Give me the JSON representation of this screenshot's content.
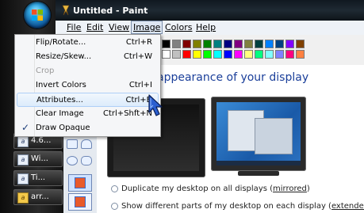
{
  "window": {
    "title": "Untitled - Paint"
  },
  "menubar": {
    "items": [
      {
        "label": "File"
      },
      {
        "label": "Edit"
      },
      {
        "label": "View"
      },
      {
        "label": "Image"
      },
      {
        "label": "Colors"
      },
      {
        "label": "Help"
      }
    ]
  },
  "image_menu": {
    "items": [
      {
        "label": "Flip/Rotate...",
        "shortcut": "Ctrl+R"
      },
      {
        "label": "Resize/Skew...",
        "shortcut": "Ctrl+W"
      },
      {
        "label": "Crop",
        "shortcut": ""
      },
      {
        "label": "Invert Colors",
        "shortcut": "Ctrl+I"
      },
      {
        "label": "Attributes...",
        "shortcut": "Ctrl+E"
      },
      {
        "label": "Clear Image",
        "shortcut": "Ctrl+Shft+N"
      },
      {
        "label": "Draw Opaque",
        "shortcut": "",
        "check": "✓"
      }
    ]
  },
  "taskbar": {
    "items": [
      {
        "label": "4.6...",
        "icon": "document-icon"
      },
      {
        "label": "Wi...",
        "icon": "document-icon"
      },
      {
        "label": "Ti...",
        "icon": "document-icon"
      },
      {
        "label": "arr...",
        "icon": "document-icon"
      }
    ]
  },
  "content": {
    "heading": "appearance of your display",
    "options": [
      {
        "pre": "Duplicate my desktop on all displays (",
        "u": "mirrored",
        "post": ")"
      },
      {
        "pre": "Show different parts of my desktop on each display (",
        "u": "extended",
        "post": ")"
      }
    ]
  },
  "palette": {
    "colors": [
      "#000000",
      "#808080",
      "#800000",
      "#808000",
      "#008000",
      "#008080",
      "#000080",
      "#800080",
      "#808040",
      "#004040",
      "#0080ff",
      "#004080",
      "#8000ff",
      "#804000",
      "#ffffff",
      "#c0c0c0",
      "#ff0000",
      "#ffff00",
      "#00ff00",
      "#00ffff",
      "#0000ff",
      "#ff00ff",
      "#ffff80",
      "#00ff80",
      "#80ffff",
      "#8080ff",
      "#ff0080",
      "#ff8040"
    ]
  },
  "colors": {
    "menu_highlight": "#dcebfb",
    "heading": "#1b3f9a"
  }
}
